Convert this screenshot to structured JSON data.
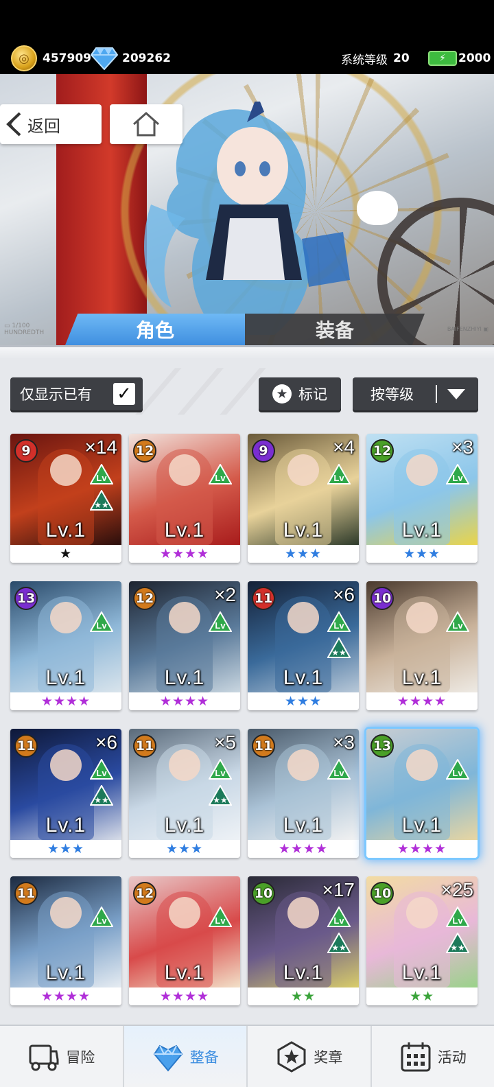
{
  "resources": {
    "gold": "457909",
    "gems": "209262",
    "system_level_label": "系统等级",
    "system_level": "20",
    "energy": "2000",
    "gold_icon": "coin-icon",
    "gem_icon": "diamond-icon",
    "energy_icon": "battery-icon"
  },
  "nav_buttons": {
    "back_label": "返回",
    "back_icon": "chevron-left-icon",
    "home_icon": "home-icon"
  },
  "tabs": [
    {
      "label": "角色",
      "active": true
    },
    {
      "label": "装备",
      "active": false
    }
  ],
  "filters": {
    "owned_only_label": "仅显示已有",
    "owned_only_checked": true,
    "mark_label": "标记",
    "sort_label": "按等级"
  },
  "cards": [
    {
      "badge": "9",
      "badge_color": "#d2302a",
      "count": "×14",
      "lv": "Lv.1",
      "stars": "★",
      "star_color": "#111111",
      "lvup": true,
      "starup": true,
      "palette": [
        "#6a1510",
        "#c2401c",
        "#2a0e0c"
      ]
    },
    {
      "badge": "12",
      "badge_color": "#d27a1c",
      "count": "",
      "lv": "Lv.1",
      "stars": "★★★★",
      "star_color": "#b02ed8",
      "lvup": true,
      "starup": false,
      "palette": [
        "#f1e2dc",
        "#d45a4a",
        "#a81c1c"
      ]
    },
    {
      "badge": "9",
      "badge_color": "#7a2ed0",
      "count": "×4",
      "lv": "Lv.1",
      "stars": "★★★",
      "star_color": "#2f7de0",
      "lvup": true,
      "starup": false,
      "palette": [
        "#6a5a3a",
        "#e8d29a",
        "#2d3a2a"
      ]
    },
    {
      "badge": "12",
      "badge_color": "#4aa028",
      "count": "×3",
      "lv": "Lv.1",
      "stars": "★★★",
      "star_color": "#2f7de0",
      "lvup": true,
      "starup": false,
      "palette": [
        "#bfe0f2",
        "#8cc6ea",
        "#e9d44a"
      ]
    },
    {
      "badge": "13",
      "badge_color": "#7a2ed0",
      "count": "",
      "lv": "Lv.1",
      "stars": "★★★★",
      "star_color": "#b02ed8",
      "lvup": true,
      "starup": false,
      "palette": [
        "#2a4a6a",
        "#8fb8d8",
        "#d9e4ec"
      ]
    },
    {
      "badge": "12",
      "badge_color": "#d27a1c",
      "count": "×2",
      "lv": "Lv.1",
      "stars": "★★★★",
      "star_color": "#b02ed8",
      "lvup": true,
      "starup": false,
      "palette": [
        "#1e2430",
        "#5a7a9a",
        "#c9d6e0"
      ]
    },
    {
      "badge": "11",
      "badge_color": "#d2302a",
      "count": "×6",
      "lv": "Lv.1",
      "stars": "★★★",
      "star_color": "#2f7de0",
      "lvup": true,
      "starup": true,
      "palette": [
        "#142036",
        "#3a6a9a",
        "#b8c8d8"
      ]
    },
    {
      "badge": "10",
      "badge_color": "#7a2ed0",
      "count": "",
      "lv": "Lv.1",
      "stars": "★★★★",
      "star_color": "#b02ed8",
      "lvup": true,
      "starup": false,
      "palette": [
        "#4a3a2e",
        "#c9b29a",
        "#eeeae4"
      ]
    },
    {
      "badge": "11",
      "badge_color": "#d27a1c",
      "count": "×6",
      "lv": "Lv.1",
      "stars": "★★★",
      "star_color": "#2f7de0",
      "lvup": true,
      "starup": true,
      "palette": [
        "#0e1838",
        "#2a4aa0",
        "#d8dde8"
      ]
    },
    {
      "badge": "11",
      "badge_color": "#d27a1c",
      "count": "×5",
      "lv": "Lv.1",
      "stars": "★★★",
      "star_color": "#2f7de0",
      "lvup": true,
      "starup": true,
      "palette": [
        "#5a6a7a",
        "#c9d8e6",
        "#eef2f6"
      ]
    },
    {
      "badge": "11",
      "badge_color": "#d27a1c",
      "count": "×3",
      "lv": "Lv.1",
      "stars": "★★★★",
      "star_color": "#b02ed8",
      "lvup": true,
      "starup": false,
      "palette": [
        "#4a5a6a",
        "#aac2d6",
        "#f2f2f2"
      ]
    },
    {
      "badge": "13",
      "badge_color": "#4aa028",
      "count": "",
      "lv": "Lv.1",
      "stars": "★★★★",
      "star_color": "#b02ed8",
      "lvup": true,
      "starup": false,
      "palette": [
        "#c9cdd2",
        "#7fb6d8",
        "#e8d6a2"
      ],
      "selected": true
    },
    {
      "badge": "11",
      "badge_color": "#d27a1c",
      "count": "",
      "lv": "Lv.1",
      "stars": "★★★★",
      "star_color": "#b02ed8",
      "lvup": true,
      "starup": false,
      "palette": [
        "#1c2a40",
        "#7aa0c8",
        "#e6ecf2"
      ]
    },
    {
      "badge": "12",
      "badge_color": "#d27a1c",
      "count": "",
      "lv": "Lv.1",
      "stars": "★★★★",
      "star_color": "#b02ed8",
      "lvup": true,
      "starup": false,
      "palette": [
        "#e8c8c8",
        "#d84a4a",
        "#f2e0c8"
      ]
    },
    {
      "badge": "10",
      "badge_color": "#4aa028",
      "count": "×17",
      "lv": "Lv.1",
      "stars": "★★",
      "star_color": "#3aa33a",
      "lvup": true,
      "starup": true,
      "palette": [
        "#2a2a36",
        "#6a5a8a",
        "#d8cc6a"
      ]
    },
    {
      "badge": "10",
      "badge_color": "#4aa028",
      "count": "×25",
      "lv": "Lv.1",
      "stars": "★★",
      "star_color": "#3aa33a",
      "lvup": true,
      "starup": true,
      "palette": [
        "#f2dca2",
        "#e8b8d8",
        "#9ad28a"
      ]
    }
  ],
  "bottom_nav": [
    {
      "label": "冒险",
      "icon": "truck-icon",
      "active": false
    },
    {
      "label": "整备",
      "icon": "heart-gem-icon",
      "active": true
    },
    {
      "label": "奖章",
      "icon": "medal-icon",
      "active": false
    },
    {
      "label": "活动",
      "icon": "calendar-icon",
      "active": false
    }
  ],
  "colors": {
    "accent": "#3f8fe0",
    "panel_bg": "#e6e8ec",
    "button_dark": "#3d3f44"
  }
}
